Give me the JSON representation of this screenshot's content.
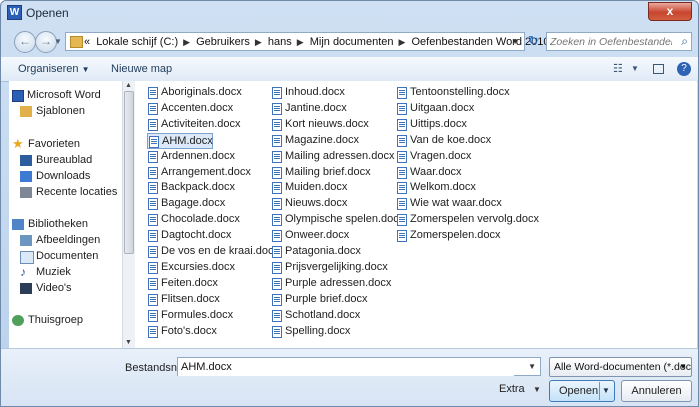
{
  "window": {
    "title": "Openen",
    "app_icon": "W",
    "close": "x"
  },
  "address": {
    "prefix": "«",
    "crumbs": [
      "Lokale schijf (C:)",
      "Gebruikers",
      "hans",
      "Mijn documenten",
      "Oefenbestanden Word 2010"
    ],
    "search_placeholder": "Zoeken in Oefenbestanden W..."
  },
  "toolbar": {
    "organize": "Organiseren",
    "organize_caret": "▼",
    "new_folder": "Nieuwe map",
    "view_icon": "☷",
    "help": "?"
  },
  "sidebar": {
    "groups": [
      {
        "label": "Microsoft Word",
        "icon": "word-icon",
        "children": [
          {
            "label": "Sjablonen",
            "icon": "folder-icon"
          }
        ]
      },
      {
        "label": "Favorieten",
        "icon": "star-icon",
        "children": [
          {
            "label": "Bureaublad",
            "icon": "desktop-icon"
          },
          {
            "label": "Downloads",
            "icon": "download-folder-icon"
          },
          {
            "label": "Recente locaties",
            "icon": "recent-locations-icon"
          }
        ]
      },
      {
        "label": "Bibliotheken",
        "icon": "libraries-icon",
        "children": [
          {
            "label": "Afbeeldingen",
            "icon": "pictures-icon"
          },
          {
            "label": "Documenten",
            "icon": "documents-icon"
          },
          {
            "label": "Muziek",
            "icon": "music-icon"
          },
          {
            "label": "Video's",
            "icon": "video-icon"
          }
        ]
      },
      {
        "label": "Thuisgroep",
        "icon": "homegroup-icon",
        "children": []
      }
    ]
  },
  "files": {
    "columns": [
      [
        "Aboriginals.docx",
        "Accenten.docx",
        "Activiteiten.docx",
        "AHM.docx",
        "Ardennen.docx",
        "Arrangement.docx",
        "Backpack.docx",
        "Bagage.docx",
        "Chocolade.docx",
        "Dagtocht.docx",
        "De vos en de kraai.docx",
        "Excursies.docx",
        "Feiten.docx",
        "Flitsen.docx",
        "Formules.docx",
        "Foto's.docx"
      ],
      [
        "Inhoud.docx",
        "Jantine.docx",
        "Kort nieuws.docx",
        "Magazine.docx",
        "Mailing adressen.docx",
        "Mailing brief.docx",
        "Muiden.docx",
        "Nieuws.docx",
        "Olympische spelen.docx",
        "Onweer.docx",
        "Patagonia.docx",
        "Prijsvergelijking.docx",
        "Purple adressen.docx",
        "Purple brief.docx",
        "Schotland.docx",
        "Spelling.docx"
      ],
      [
        "Tentoonstelling.docx",
        "Uitgaan.docx",
        "Uittips.docx",
        "Van de koe.docx",
        "Vragen.docx",
        "Waar.docx",
        "Welkom.docx",
        "Wie wat waar.docx",
        "Zomerspelen vervolg.docx",
        "Zomerspelen.docx"
      ]
    ],
    "selected": "AHM.docx"
  },
  "bottom": {
    "filename_label": "Bestandsnaam:",
    "filename_value": "AHM.docx",
    "filter": "Alle Word-documenten (*.docx",
    "extra": "Extra",
    "open": "Openen",
    "cancel": "Annuleren"
  },
  "colors": {
    "accent": "#3d7bbd",
    "selection": "#dce9f8"
  }
}
